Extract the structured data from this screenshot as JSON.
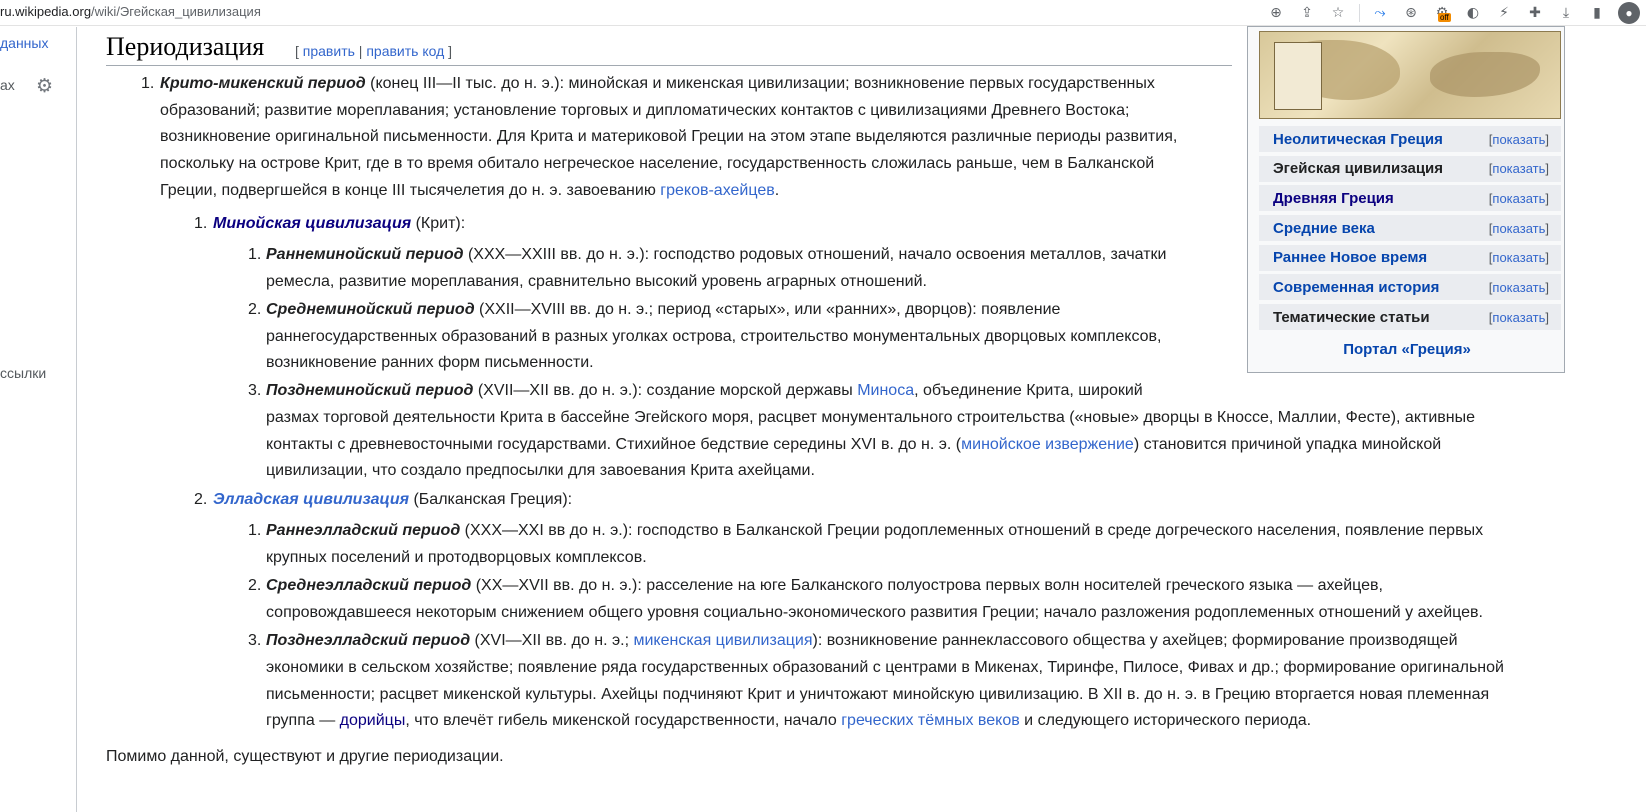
{
  "browser": {
    "url_domain": "ru.wikipedia.org",
    "url_path": "/wiki/Эгейская_цивилизация",
    "extension_badge": "off"
  },
  "sidebar": {
    "item1": "данных",
    "item2": "ах",
    "item3": "ссылки"
  },
  "section": {
    "title": "Периодизация",
    "edit_open": "[",
    "edit_label": "править",
    "edit_sep": "|",
    "edit_code_label": "править код",
    "edit_close": "]"
  },
  "infobox": {
    "rows": [
      {
        "label": "Неолитическая Греция",
        "toggle": "показать"
      },
      {
        "label": "Эгейская цивилизация",
        "toggle": "показать"
      },
      {
        "label": "Древняя Греция",
        "toggle": "показать"
      },
      {
        "label": "Средние века",
        "toggle": "показать"
      },
      {
        "label": "Раннее Новое время",
        "toggle": "показать"
      },
      {
        "label": "Современная история",
        "toggle": "показать"
      },
      {
        "label": "Тематические статьи",
        "toggle": "показать"
      }
    ],
    "portal": "Портал «Греция»"
  },
  "article": {
    "n1": "1.",
    "i1_title": "Крито-микенский период",
    "i1_l1": " (конец III—II тыс. до н. э.): минойская и микенская цивилизации; возникновение первых государственных",
    "i1_l2": "образований; развитие мореплавания; установление торговых и дипломатических контактов с цивилизациями Древнего Востока;",
    "i1_l3": "возникновение оригинальной письменности. Для Крита и материковой Греции на этом этапе выделяются различные периоды развития,",
    "i1_l4": "поскольку на острове Крит, где в то время обитало негреческое население, государственность сложилась раньше, чем в Балканской",
    "i1_l5": "Греции, подвергшейся в конце III тысячелетия до н. э. завоеванию ",
    "i1_l5_link": "греков-ахейцев",
    "i1_l5_end": ".",
    "s1_num": "1.",
    "s1_link": "Минойская цивилизация",
    "s1_rest": " (Крит):",
    "m1_num": "1.",
    "m1_title": "Раннеминойский период",
    "m1_l1": " (XXX—XXIII вв. до н. э.): господство родовых отношений, начало освоения металлов, зачатки",
    "m1_l2": "ремесла, развитие мореплавания, сравнительно высокий уровень аграрных отношений.",
    "m2_num": "2.",
    "m2_title": "Среднеминойский период",
    "m2_l1": " (XXII—XVIII вв. до н. э.; период «старых», или «ранних», дворцов): появление",
    "m2_l2": "раннегосударственных образований в разных уголках острова, строительство монументальных дворцовых комплексов,",
    "m2_l3": "возникновение ранних форм письменности.",
    "m3_num": "3.",
    "m3_title": "Позднеминойский период",
    "m3_l1": " (XVII—XII вв. до н. э.): создание морской державы ",
    "m3_l1_link": "Миноса",
    "m3_l1_end": ", объединение Крита, широкий",
    "m3_l2": "размах торговой деятельности Крита в бассейне Эгейского моря, расцвет монументального строительства («новые» дворцы в Кноссе, Маллии, Фесте), активные",
    "m3_l3": "контакты с древневосточными государствами. Стихийное бедствие середины XVI в. до н. э. (",
    "m3_l3_link": "минойское извержение",
    "m3_l3_end": ") становится причиной упадка минойской",
    "m3_l4": "цивилизации, что создало предпосылки для завоевания Крита ахейцами.",
    "s2_num": "2.",
    "s2_link": "Элладская цивилизация",
    "s2_rest": " (Балканская Греция):",
    "e1_num": "1.",
    "e1_title": "Раннеэлладский период",
    "e1_l1": " (XXX—XXI вв до н. э.): господство в Балканской Греции родоплеменных отношений в среде догреческого населения, появление первых",
    "e1_l2": "крупных поселений и протодворцовых комплексов.",
    "e2_num": "2.",
    "e2_title": "Среднеэлладский период",
    "e2_l1": " (XX—XVII вв. до н. э.): расселение на юге Балканского полуострова первых волн носителей греческого языка — ахейцев,",
    "e2_l2": "сопровождавшееся некоторым снижением общего уровня социально-экономического развития Греции; начало разложения родоплеменных отношений у ахейцев.",
    "e3_num": "3.",
    "e3_title": "Позднеэлладский период",
    "e3_l1": " (XVI—XII вв. до н. э.; ",
    "e3_l1_link": "микенская цивилизация",
    "e3_l1_end": "): возникновение раннеклассового общества у ахейцев; формирование производящей",
    "e3_l2": "экономики в сельском хозяйстве; появление ряда государственных образований с центрами в Микенах, Тиринфе, Пилосе, Фивах и др.; формирование оригинальной",
    "e3_l3": "письменности; расцвет микенской культуры. Ахейцы подчиняют Крит и уничтожают минойскую цивилизацию. В XII в. до н. э. в Грецию вторгается новая племенная",
    "e3_l4_a": "группа — ",
    "e3_l4_link1": "дорийцы",
    "e3_l4_b": ", что влечёт гибель микенской государственности, начало ",
    "e3_l4_link2": "греческих тёмных веков",
    "e3_l4_c": " и следующего исторического периода.",
    "footer": "Помимо данной, существуют и другие периодизации."
  }
}
